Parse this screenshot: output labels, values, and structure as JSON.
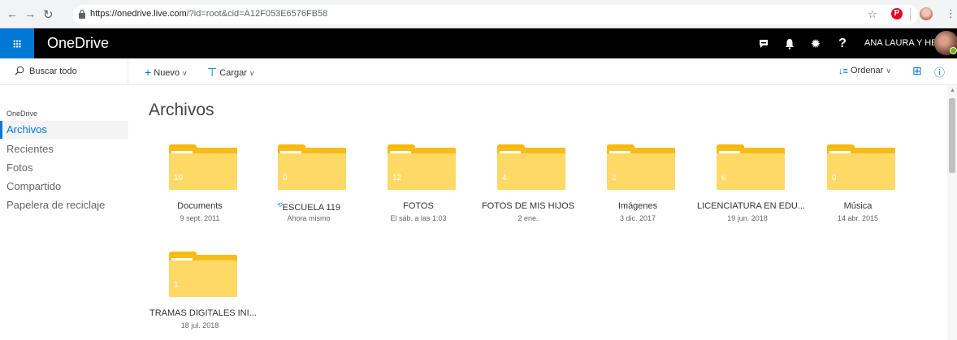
{
  "browser": {
    "url_host": "https://onedrive.live.com",
    "url_path": "/?id=root&cid=A12F053E6576FB58"
  },
  "suite": {
    "brand": "OneDrive",
    "user_name": "ANA LAURA Y HE..."
  },
  "commands": {
    "search_placeholder": "Buscar todo",
    "new_label": "Nuevo",
    "upload_label": "Cargar",
    "sort_label": "Ordenar"
  },
  "nav": {
    "heading": "OneDrive",
    "items": [
      {
        "label": "Archivos",
        "selected": true
      },
      {
        "label": "Recientes"
      },
      {
        "label": "Fotos"
      },
      {
        "label": "Compartido"
      },
      {
        "label": "Papelera de reciclaje"
      }
    ]
  },
  "main": {
    "title": "Archivos",
    "folders": [
      {
        "name": "Documents",
        "count": "10",
        "date": "9 sept. 2011"
      },
      {
        "name": "ESCUELA 119",
        "count": "0",
        "date": "Ahora mismo",
        "syncing": true
      },
      {
        "name": "FOTOS",
        "count": "12",
        "date": "El sáb. a las 1:03"
      },
      {
        "name": "FOTOS DE MIS HIJOS",
        "count": "4",
        "date": "2 ene."
      },
      {
        "name": "Imágenes",
        "count": "2",
        "date": "3 dic. 2017"
      },
      {
        "name": "LICENCIATURA EN EDU...",
        "count": "6",
        "date": "19 jun. 2018"
      },
      {
        "name": "Música",
        "count": "0",
        "date": "14 abr. 2015"
      },
      {
        "name": "TRAMAS DIGITALES INI...",
        "count": "1",
        "date": "18 jul. 2018"
      }
    ]
  },
  "colors": {
    "accent": "#0078d4",
    "folder_front": "#ffd966",
    "folder_back": "#f7bc1c"
  }
}
